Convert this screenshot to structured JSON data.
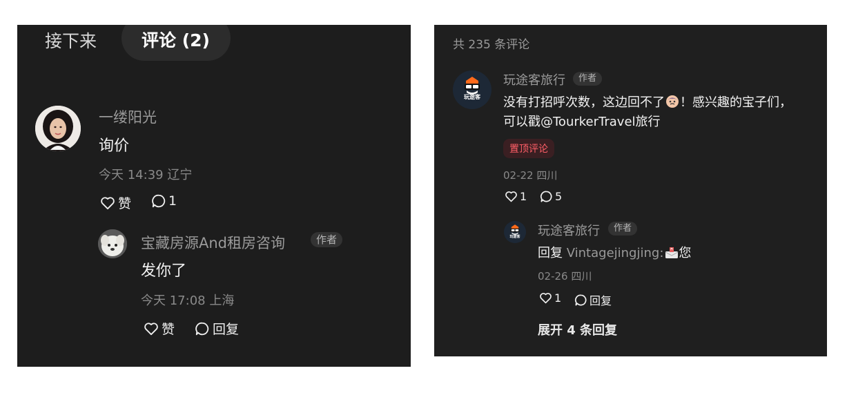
{
  "left": {
    "tabs": {
      "next_label": "接下来",
      "comments_label": "评论 (2)"
    },
    "comment": {
      "username": "一缕阳光",
      "text": "询价",
      "time_location": "今天 14:39 辽宁",
      "like_label": "赞",
      "reply_count": "1"
    },
    "reply": {
      "username": "宝藏房源And租房咨询",
      "author_tag": "作者",
      "text": "发你了",
      "time_location": "今天 17:08 上海",
      "like_label": "赞",
      "reply_label": "回复"
    }
  },
  "right": {
    "total_comments": "共 235 条评论",
    "comment": {
      "username": "玩途客旅行",
      "author_tag": "作者",
      "text_line1": "没有打招呼次数，这边回不了",
      "text_line1_end": "！感兴趣的宝子们，",
      "text_line2": "可以戳@TourkerTravel旅行",
      "pinned_label": "置顶评论",
      "date_location": "02-22 四川",
      "like_count": "1",
      "reply_count": "5",
      "avatar_text": "玩途客"
    },
    "reply": {
      "username": "玩途客旅行",
      "author_tag": "作者",
      "reply_prefix": "回复",
      "reply_to": "Vintagejingjing:",
      "text_end": "您",
      "date_location": "02-26 四川",
      "like_count": "1",
      "reply_label": "回复",
      "avatar_text": "玩途客"
    },
    "expand_label": "展开 4 条回复"
  },
  "colors": {
    "panel_bg": "#1d1d1d",
    "pinned_tag_text": "#ff5e67",
    "pinned_tag_bg": "#3a1f22",
    "muted_text": "#8a8a8a"
  },
  "icons": [
    "heart-icon",
    "comment-bubble-icon",
    "emoji-face-icon",
    "envelope-emoji-icon"
  ]
}
